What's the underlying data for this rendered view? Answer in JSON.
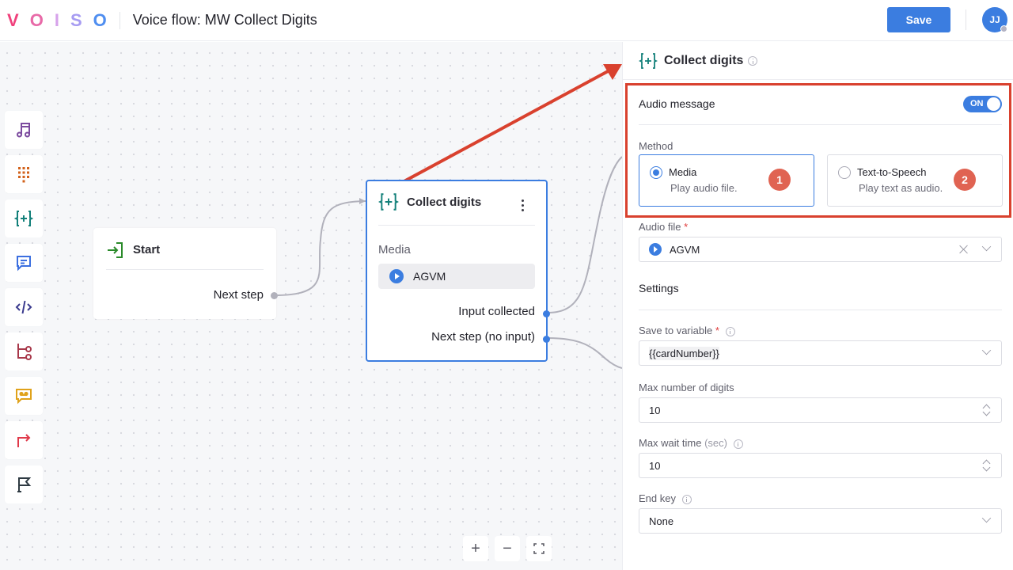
{
  "header": {
    "logo_letters": [
      {
        "char": "V",
        "color": "#f0417c"
      },
      {
        "char": "O",
        "color": "#e86aa8"
      },
      {
        "char": "I",
        "color": "#d6a2ea"
      },
      {
        "char": "S",
        "color": "#a79cf2"
      },
      {
        "char": "O",
        "color": "#4f8ef0"
      }
    ],
    "title": "Voice flow: MW Collect Digits",
    "save_label": "Save",
    "avatar_initials": "JJ"
  },
  "toolbox": {
    "items": [
      {
        "name": "play-audio",
        "icon": "music-note-icon",
        "color": "#7b4a9e"
      },
      {
        "name": "dial-pad",
        "icon": "dialpad-icon",
        "color": "#d2611a"
      },
      {
        "name": "collect-digits",
        "icon": "collect-digits-icon",
        "color": "#13807a"
      },
      {
        "name": "message",
        "icon": "chat-bubble-icon",
        "color": "#3b6fe0"
      },
      {
        "name": "code",
        "icon": "code-icon",
        "color": "#3a3a8e"
      },
      {
        "name": "branch",
        "icon": "branch-icon",
        "color": "#a8384a"
      },
      {
        "name": "voicemail",
        "icon": "voicemail-icon",
        "color": "#e0a21a"
      },
      {
        "name": "transfer",
        "icon": "redirect-arrow-icon",
        "color": "#e0394a"
      },
      {
        "name": "end",
        "icon": "flag-icon",
        "color": "#2e3a42"
      }
    ]
  },
  "canvas": {
    "start_node": {
      "title": "Start",
      "port_label": "Next step"
    },
    "collect_node": {
      "title": "Collect digits",
      "media_label": "Media",
      "media_value": "AGVM",
      "ports": [
        "Input collected",
        "Next step (no input)"
      ]
    },
    "zoom_controls": {
      "zoom_in": "+",
      "zoom_out": "−"
    }
  },
  "panel": {
    "title": "Collect digits",
    "audio_message_label": "Audio message",
    "audio_message_toggle": "ON",
    "audio_message_enabled": true,
    "method_label": "Method",
    "methods": [
      {
        "title": "Media",
        "description": "Play audio file.",
        "selected": true,
        "badge": "1"
      },
      {
        "title": "Text-to-Speech",
        "description": "Play text as audio.",
        "selected": false,
        "badge": "2"
      }
    ],
    "audio_file_label": "Audio file",
    "required_mark": "*",
    "audio_file_value": "AGVM",
    "settings_heading": "Settings",
    "save_to_variable_label": "Save to variable",
    "save_to_variable_value": "{{cardNumber}}",
    "max_digits_label": "Max number of digits",
    "max_digits_value": "10",
    "max_wait_label": "Max wait time",
    "max_wait_unit": "(sec)",
    "max_wait_value": "10",
    "end_key_label": "End key",
    "end_key_value": "None"
  },
  "annotation": {
    "color": "#d9412e"
  }
}
